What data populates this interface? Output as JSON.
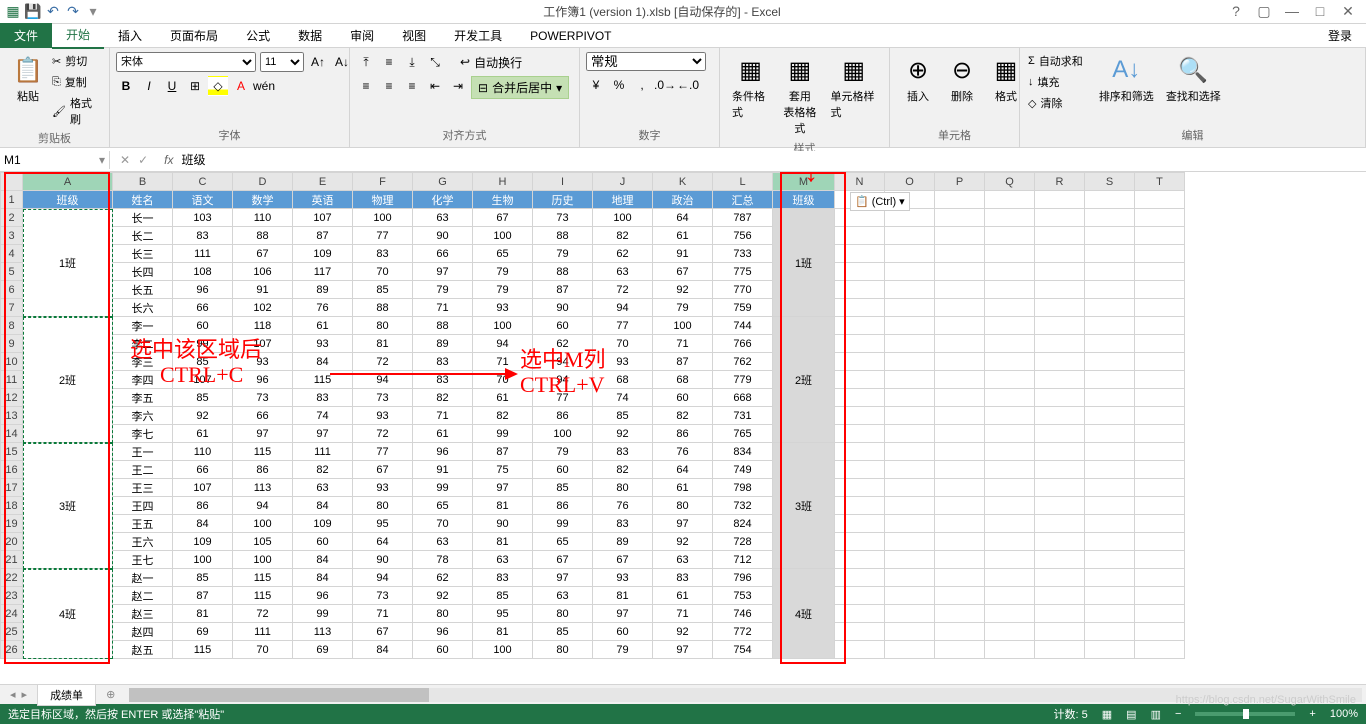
{
  "app": {
    "title": "工作簿1 (version 1).xlsb [自动保存的] - Excel"
  },
  "win": {
    "help": "?",
    "restore": "▢",
    "min": "—",
    "max": "□",
    "close": "✕"
  },
  "login": "登录",
  "tabs": {
    "file": "文件",
    "home": "开始",
    "insert": "插入",
    "layout": "页面布局",
    "formula": "公式",
    "data": "数据",
    "review": "审阅",
    "view": "视图",
    "dev": "开发工具",
    "pp": "POWERPIVOT"
  },
  "ribbon": {
    "clipboard": {
      "paste": "粘贴",
      "cut": "剪切",
      "copy": "复制",
      "painter": "格式刷",
      "label": "剪贴板"
    },
    "font": {
      "name": "宋体",
      "size": "11",
      "label": "字体"
    },
    "align": {
      "wrap": "自动换行",
      "merge": "合并后居中",
      "label": "对齐方式"
    },
    "number": {
      "fmt": "常规",
      "label": "数字"
    },
    "styles": {
      "cond": "条件格式",
      "table": "套用\n表格格式",
      "cell": "单元格样式",
      "label": "样式"
    },
    "cells": {
      "insert": "插入",
      "delete": "删除",
      "format": "格式",
      "label": "单元格"
    },
    "editing": {
      "sum": "自动求和",
      "fill": "填充",
      "clear": "清除",
      "sort": "排序和筛选",
      "find": "查找和选择",
      "label": "编辑"
    }
  },
  "namebox": "M1",
  "formula": "班级",
  "columns": [
    "A",
    "B",
    "C",
    "D",
    "E",
    "F",
    "G",
    "H",
    "I",
    "J",
    "K",
    "L",
    "M",
    "N",
    "O",
    "P",
    "Q",
    "R",
    "S",
    "T"
  ],
  "headers": [
    "班级",
    "姓名",
    "语文",
    "数学",
    "英语",
    "物理",
    "化学",
    "生物",
    "历史",
    "地理",
    "政治",
    "汇总"
  ],
  "m_header": "班级",
  "classes": [
    "1班",
    "2班",
    "3班",
    "4班"
  ],
  "rows": [
    [
      "长一",
      103,
      110,
      107,
      100,
      63,
      67,
      73,
      100,
      64,
      787
    ],
    [
      "长二",
      83,
      88,
      87,
      77,
      90,
      100,
      88,
      82,
      61,
      756
    ],
    [
      "长三",
      111,
      67,
      109,
      83,
      66,
      65,
      79,
      62,
      91,
      733
    ],
    [
      "长四",
      108,
      106,
      117,
      70,
      97,
      79,
      88,
      63,
      67,
      775
    ],
    [
      "长五",
      96,
      91,
      89,
      85,
      79,
      79,
      87,
      72,
      92,
      770
    ],
    [
      "长六",
      66,
      102,
      76,
      88,
      71,
      93,
      90,
      94,
      79,
      759
    ],
    [
      "李一",
      60,
      118,
      61,
      80,
      88,
      100,
      60,
      77,
      100,
      744
    ],
    [
      "李二",
      99,
      107,
      93,
      81,
      89,
      94,
      62,
      70,
      71,
      766
    ],
    [
      "李三",
      85,
      93,
      84,
      72,
      83,
      71,
      94,
      93,
      87,
      762
    ],
    [
      "李四",
      107,
      96,
      115,
      94,
      83,
      70,
      94,
      68,
      68,
      779
    ],
    [
      "李五",
      85,
      73,
      83,
      73,
      82,
      61,
      77,
      74,
      60,
      668
    ],
    [
      "李六",
      92,
      66,
      74,
      93,
      71,
      82,
      86,
      85,
      82,
      731
    ],
    [
      "李七",
      61,
      97,
      97,
      72,
      61,
      99,
      100,
      92,
      86,
      765
    ],
    [
      "王一",
      110,
      115,
      111,
      77,
      96,
      87,
      79,
      83,
      76,
      834
    ],
    [
      "王二",
      66,
      86,
      82,
      67,
      91,
      75,
      60,
      82,
      64,
      749
    ],
    [
      "王三",
      107,
      113,
      63,
      93,
      99,
      97,
      85,
      80,
      61,
      798
    ],
    [
      "王四",
      86,
      94,
      84,
      80,
      65,
      81,
      86,
      76,
      80,
      732
    ],
    [
      "王五",
      84,
      100,
      109,
      95,
      70,
      90,
      99,
      83,
      97,
      824
    ],
    [
      "王六",
      109,
      105,
      60,
      64,
      63,
      81,
      65,
      89,
      92,
      728
    ],
    [
      "王七",
      100,
      100,
      84,
      90,
      78,
      63,
      67,
      67,
      63,
      712
    ],
    [
      "赵一",
      85,
      115,
      84,
      94,
      62,
      83,
      97,
      93,
      83,
      796
    ],
    [
      "赵二",
      87,
      115,
      96,
      73,
      92,
      85,
      63,
      81,
      61,
      753
    ],
    [
      "赵三",
      81,
      72,
      99,
      71,
      80,
      95,
      80,
      97,
      71,
      746
    ],
    [
      "赵四",
      69,
      111,
      113,
      67,
      96,
      81,
      85,
      60,
      92,
      772
    ],
    [
      "赵五",
      115,
      70,
      69,
      84,
      60,
      100,
      80,
      79,
      97,
      754
    ]
  ],
  "annot": {
    "sel": "选中该区域后",
    "ctrlc": "CTRL+C",
    "selm": "选中M列",
    "ctrlv": "CTRL+V"
  },
  "paste_opt": "(Ctrl)",
  "sheet_tab": "成绩单",
  "status": {
    "msg": "选定目标区域，然后按 ENTER 或选择\"粘贴\"",
    "count": "计数: 5",
    "zoom": "100%"
  },
  "watermark": "https://blog.csdn.net/SugarWithSmile"
}
